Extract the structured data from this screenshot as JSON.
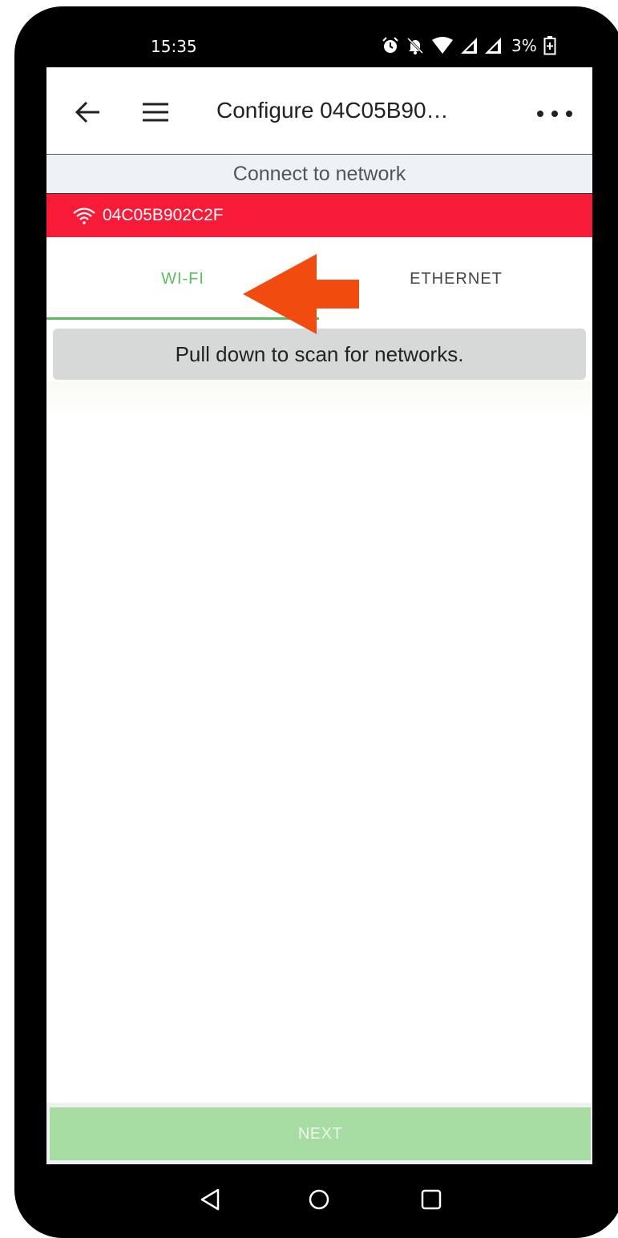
{
  "status_bar": {
    "time": "15:35",
    "battery": "3%",
    "icons": [
      "alarm-icon",
      "notifications-off-icon",
      "wifi-signal-icon",
      "cell-signal-icon",
      "cell-signal-icon",
      "battery-charging-icon"
    ]
  },
  "app_bar": {
    "title": "Configure 04C05B90…",
    "back_icon": "arrow-back-icon",
    "menu_icon": "hamburger-menu-icon",
    "overflow_icon": "more-horiz-icon"
  },
  "section_header": "Connect to network",
  "device_banner": {
    "icon": "wifi-icon",
    "device_id": "04C05B902C2F",
    "color": "#f71b38"
  },
  "tabs": [
    {
      "label": "WI-FI",
      "selected": true
    },
    {
      "label": "ETHERNET",
      "selected": false
    }
  ],
  "annotation": {
    "icon": "arrow-left-annotation",
    "color": "#f24b0f"
  },
  "scan_hint": "Pull down to scan for networks.",
  "next_button": {
    "label": "NEXT",
    "enabled": false,
    "color": "#a7dca3"
  },
  "nav_bar": {
    "icons": [
      "nav-back-icon",
      "nav-home-icon",
      "nav-recents-icon"
    ]
  },
  "colors": {
    "accent_green": "#5dbb5d",
    "header_bg": "#eef2f6"
  }
}
